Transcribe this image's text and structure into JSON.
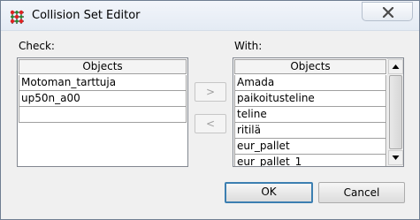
{
  "window": {
    "title": "Collision Set Editor",
    "icon": "collision-app-icon"
  },
  "check": {
    "label": "Check:",
    "header": "Objects",
    "items": [
      "Motoman_tarttuja",
      "up50n_a00"
    ]
  },
  "with": {
    "label": "With:",
    "header": "Objects",
    "items": [
      "Amada",
      "paikoitusteline",
      "teline",
      "ritilä",
      "eur_pallet",
      "eur_pallet_1"
    ]
  },
  "transfer": {
    "add_label": ">",
    "remove_label": "<"
  },
  "buttons": {
    "ok_label": "OK",
    "cancel_label": "Cancel"
  }
}
